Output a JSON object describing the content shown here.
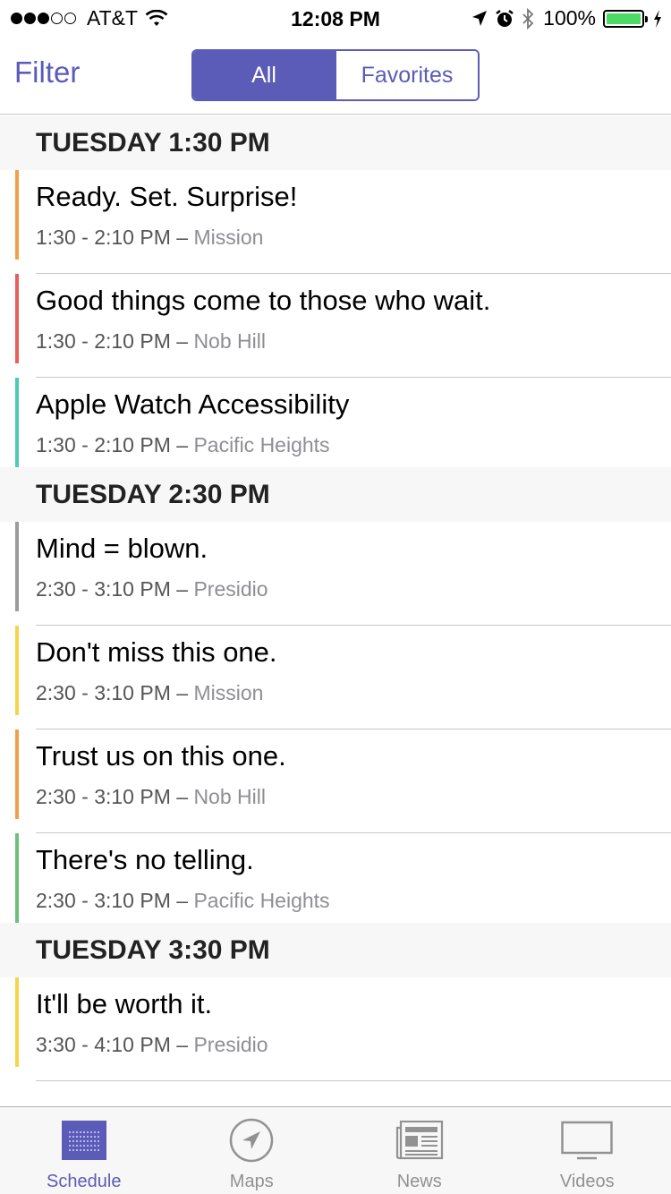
{
  "status_bar": {
    "carrier": "AT&T",
    "time": "12:08 PM",
    "battery": "100%",
    "signal_bars_filled": 3,
    "signal_bars_total": 5
  },
  "nav": {
    "filter_label": "Filter",
    "segments": [
      {
        "label": "All",
        "selected": true
      },
      {
        "label": "Favorites",
        "selected": false
      }
    ]
  },
  "sections": [
    {
      "header": "TUESDAY 1:30 PM",
      "sessions": [
        {
          "title": "Ready. Set. Surprise!",
          "time": "1:30 - 2:10 PM –",
          "room": "Mission",
          "color": "#f0a04b"
        },
        {
          "title": "Good things come to those who wait.",
          "time": "1:30 - 2:10 PM –",
          "room": "Nob Hill",
          "color": "#e8605c"
        },
        {
          "title": "Apple Watch Accessibility",
          "time": "1:30 - 2:10 PM –",
          "room": "Pacific Heights",
          "color": "#4fcab5"
        }
      ]
    },
    {
      "header": "TUESDAY 2:30 PM",
      "sessions": [
        {
          "title": "Mind = blown.",
          "time": "2:30 - 3:10 PM –",
          "room": "Presidio",
          "color": "#9b9b9b"
        },
        {
          "title": "Don't miss this one.",
          "time": "2:30 - 3:10 PM –",
          "room": "Mission",
          "color": "#f5d547"
        },
        {
          "title": "Trust us on this one.",
          "time": "2:30 - 3:10 PM –",
          "room": "Nob Hill",
          "color": "#f0a04b"
        },
        {
          "title": "There's no telling.",
          "time": "2:30 - 3:10 PM –",
          "room": "Pacific Heights",
          "color": "#6cc07a"
        }
      ]
    },
    {
      "header": "TUESDAY 3:30 PM",
      "sessions": [
        {
          "title": "It'll be worth it.",
          "time": "3:30 - 4:10 PM –",
          "room": "Presidio",
          "color": "#f5d547"
        }
      ]
    }
  ],
  "tabs": [
    {
      "label": "Schedule",
      "icon": "calendar-grid-icon",
      "active": true
    },
    {
      "label": "Maps",
      "icon": "compass-arrow-icon",
      "active": false
    },
    {
      "label": "News",
      "icon": "newspaper-icon",
      "active": false
    },
    {
      "label": "Videos",
      "icon": "tv-icon",
      "active": false
    }
  ],
  "colors": {
    "accent": "#5b5bb8",
    "inactive_tab": "#929292",
    "section_bg": "#f7f7f7"
  }
}
